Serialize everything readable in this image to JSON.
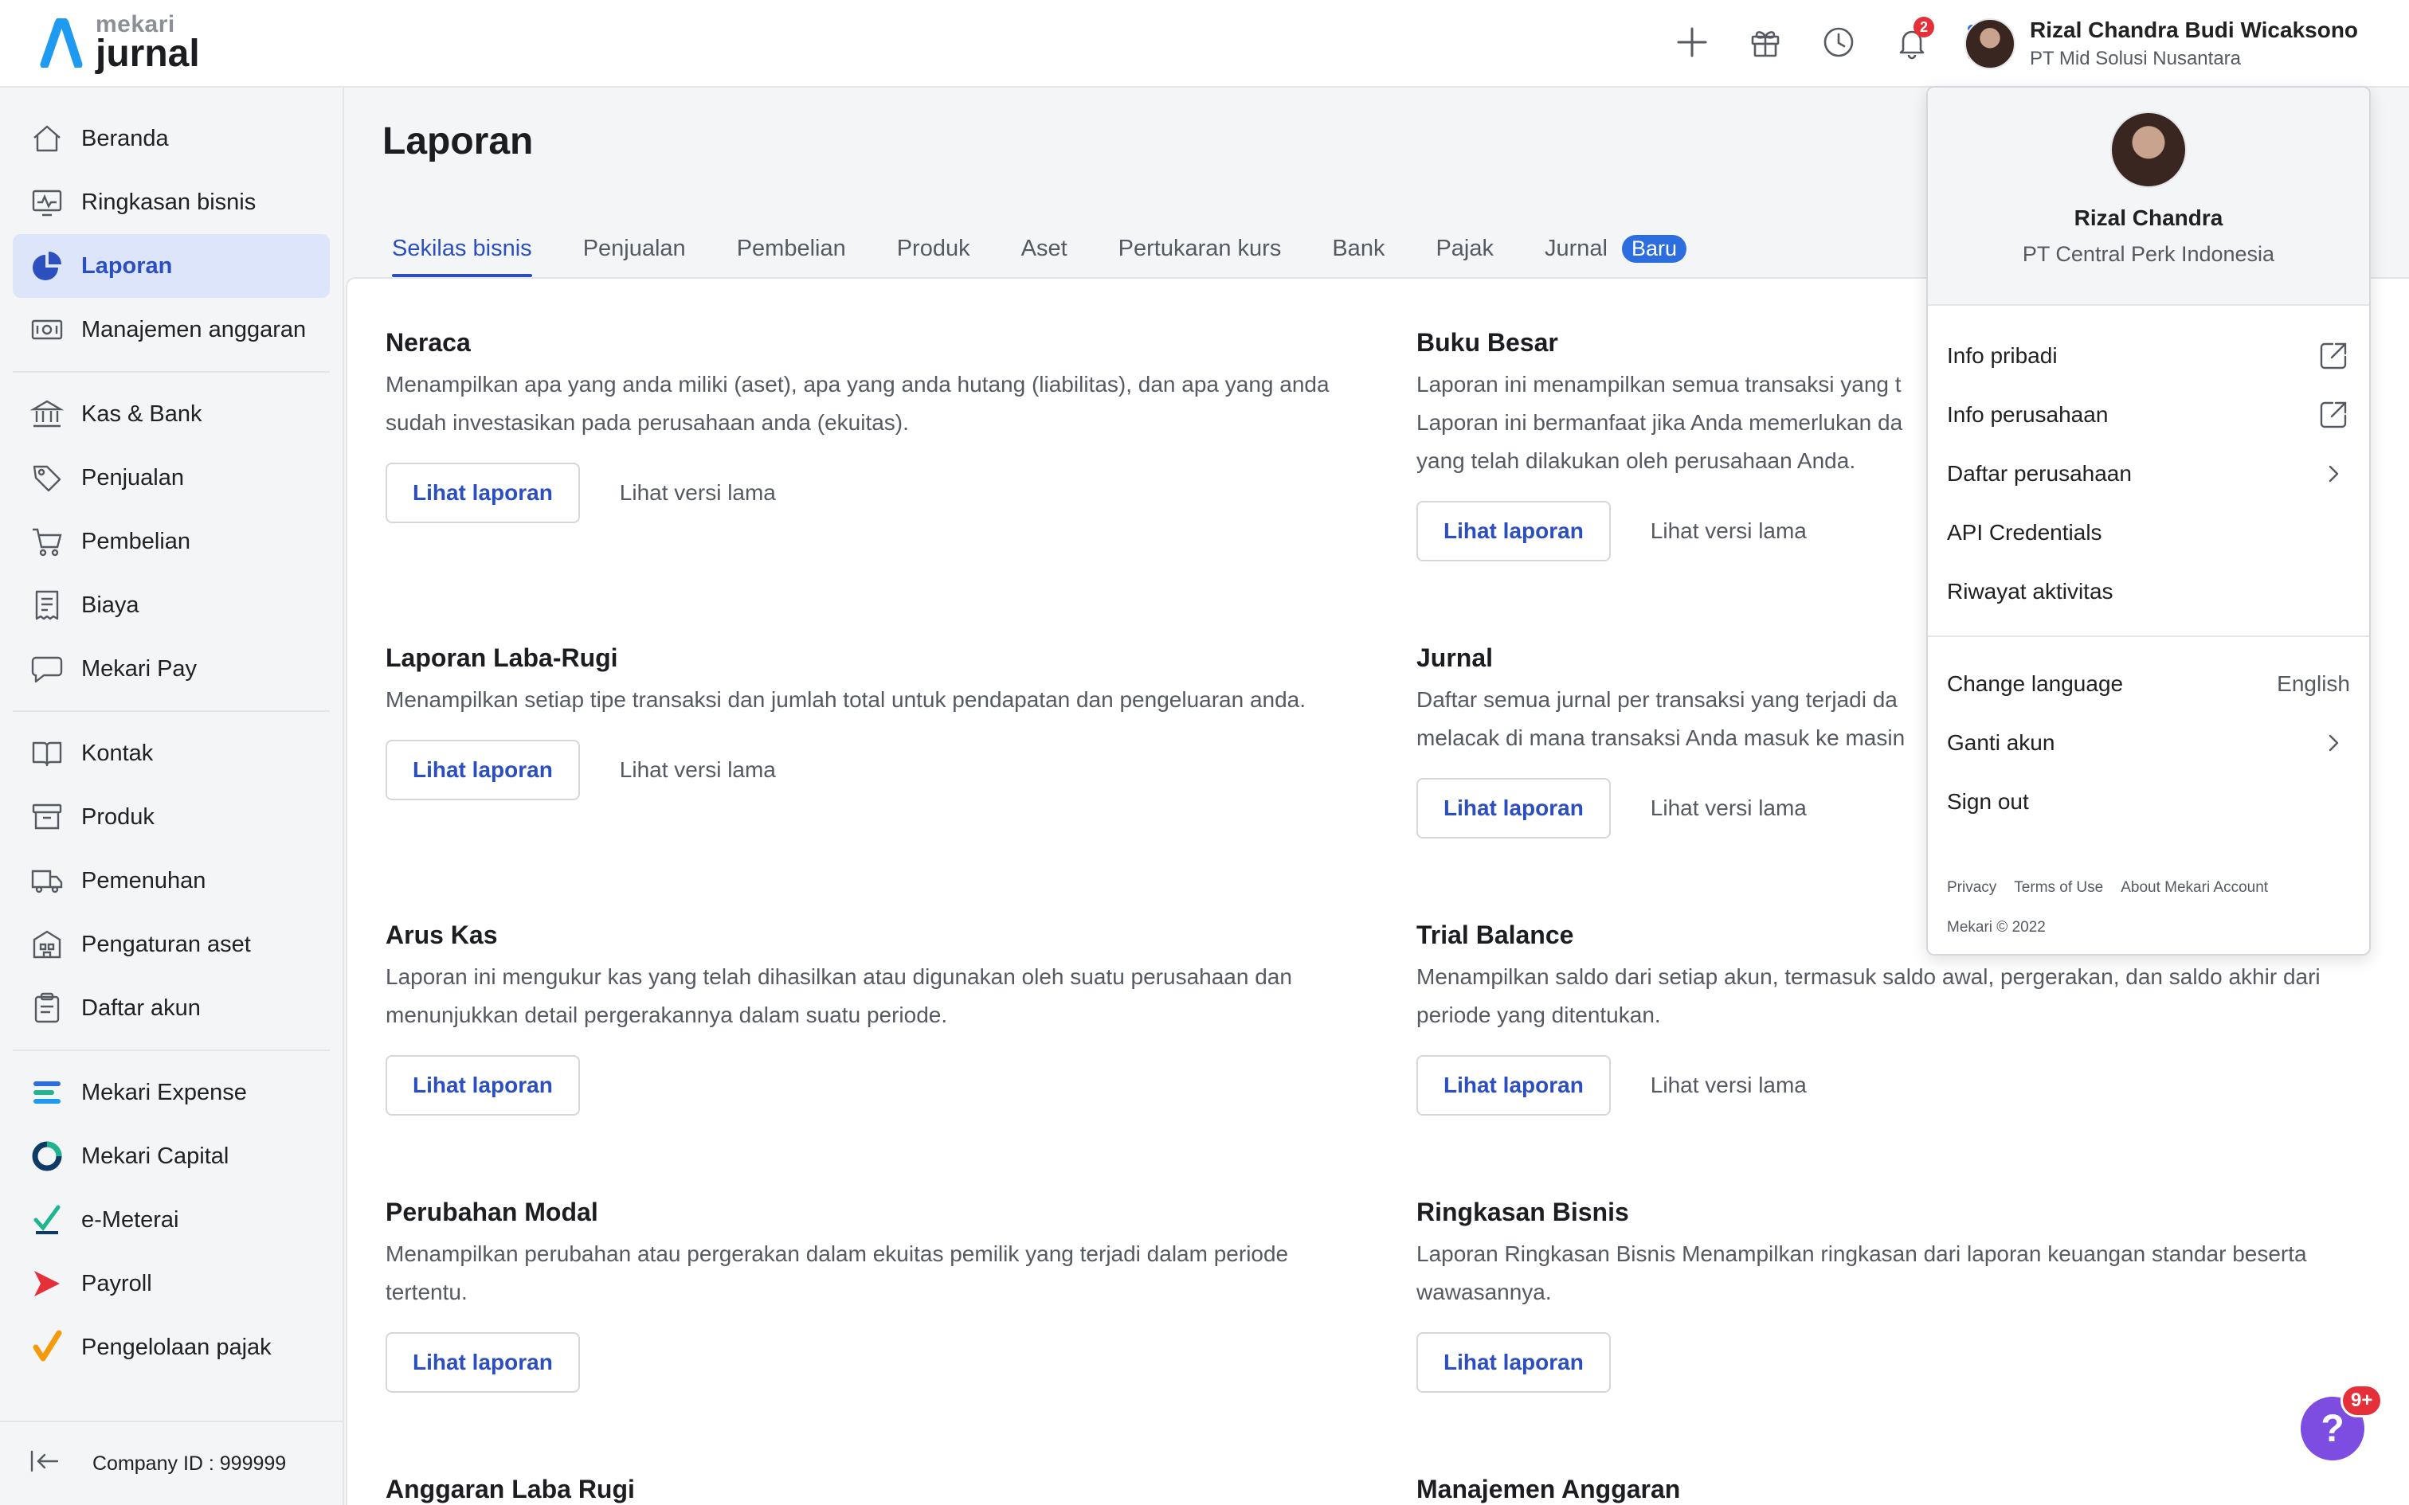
{
  "brand": {
    "name_small": "mekari",
    "name_big": "jurnal"
  },
  "topbar": {
    "notification_count": "2",
    "user_name": "Rizal Chandra Budi Wicaksono",
    "user_company": "PT Mid Solusi Nusantara"
  },
  "sidebar": {
    "groups": [
      [
        {
          "label": "Beranda",
          "icon": "home-icon"
        },
        {
          "label": "Ringkasan bisnis",
          "icon": "monitor-chart-icon"
        },
        {
          "label": "Laporan",
          "icon": "pie-chart-icon",
          "active": true
        },
        {
          "label": "Manajemen anggaran",
          "icon": "money-icon"
        }
      ],
      [
        {
          "label": "Kas & Bank",
          "icon": "bank-icon"
        },
        {
          "label": "Penjualan",
          "icon": "tag-icon"
        },
        {
          "label": "Pembelian",
          "icon": "cart-icon"
        },
        {
          "label": "Biaya",
          "icon": "receipt-icon"
        },
        {
          "label": "Mekari Pay",
          "icon": "chat-bubble-icon"
        }
      ],
      [
        {
          "label": "Kontak",
          "icon": "book-icon"
        },
        {
          "label": "Produk",
          "icon": "box-icon"
        },
        {
          "label": "Pemenuhan",
          "icon": "truck-icon"
        },
        {
          "label": "Pengaturan aset",
          "icon": "building-icon"
        },
        {
          "label": "Daftar akun",
          "icon": "clipboard-icon"
        }
      ],
      [
        {
          "label": "Mekari Expense",
          "icon": "mekari-expense-icon"
        },
        {
          "label": "Mekari Capital",
          "icon": "mekari-capital-icon"
        },
        {
          "label": "e-Meterai",
          "icon": "e-meterai-icon"
        },
        {
          "label": "Payroll",
          "icon": "payroll-icon"
        },
        {
          "label": "Pengelolaan pajak",
          "icon": "tax-check-icon"
        }
      ]
    ],
    "footer": "Company ID : 999999"
  },
  "main": {
    "title": "Laporan",
    "tabs": [
      {
        "label": "Sekilas bisnis",
        "active": true
      },
      {
        "label": "Penjualan"
      },
      {
        "label": "Pembelian"
      },
      {
        "label": "Produk"
      },
      {
        "label": "Aset"
      },
      {
        "label": "Pertukaran kurs"
      },
      {
        "label": "Bank"
      },
      {
        "label": "Pajak"
      },
      {
        "label": "Jurnal",
        "badge": "Baru"
      }
    ],
    "reports": [
      {
        "title": "Neraca",
        "desc": "Menampilkan apa yang anda miliki (aset), apa yang anda hutang (liabilitas), dan apa yang anda sudah investasikan pada perusahaan anda (ekuitas).",
        "primary": "Lihat laporan",
        "secondary": "Lihat versi lama"
      },
      {
        "title": "Buku Besar",
        "desc": "Laporan ini menampilkan semua transaksi yang t Laporan ini bermanfaat jika Anda memerlukan da yang telah dilakukan oleh perusahaan Anda.",
        "primary": "Lihat laporan",
        "secondary": "Lihat versi lama"
      },
      {
        "title": "Laporan Laba-Rugi",
        "desc": "Menampilkan setiap tipe transaksi dan jumlah total untuk pendapatan dan pengeluaran anda.",
        "primary": "Lihat laporan",
        "secondary": "Lihat versi lama"
      },
      {
        "title": "Jurnal",
        "desc": "Daftar semua jurnal per transaksi yang terjadi da melacak di mana transaksi Anda masuk ke masin",
        "primary": "Lihat laporan",
        "secondary": "Lihat versi lama"
      },
      {
        "title": "Arus Kas",
        "desc": "Laporan ini mengukur kas yang telah dihasilkan atau digunakan oleh suatu perusahaan dan menunjukkan detail pergerakannya dalam suatu periode.",
        "primary": "Lihat laporan",
        "secondary": ""
      },
      {
        "title": "Trial Balance",
        "desc": "Menampilkan saldo dari setiap akun, termasuk saldo awal, pergerakan, dan saldo akhir dari periode yang ditentukan.",
        "primary": "Lihat laporan",
        "secondary": "Lihat versi lama"
      },
      {
        "title": "Perubahan Modal",
        "desc": "Menampilkan perubahan atau pergerakan dalam ekuitas pemilik yang terjadi dalam periode tertentu.",
        "primary": "Lihat laporan",
        "secondary": ""
      },
      {
        "title": "Ringkasan Bisnis",
        "desc": "Laporan Ringkasan Bisnis Menampilkan ringkasan dari laporan keuangan standar beserta wawasannya.",
        "primary": "Lihat laporan",
        "secondary": ""
      },
      {
        "title": "Anggaran Laba Rugi",
        "desc": "",
        "primary": "",
        "secondary": ""
      },
      {
        "title": "Manajemen Anggaran",
        "desc": "",
        "primary": "",
        "secondary": ""
      }
    ]
  },
  "dropdown": {
    "name": "Rizal Chandra",
    "company": "PT Central Perk Indonesia",
    "items1": [
      {
        "label": "Info pribadi",
        "icon": "external-link-icon"
      },
      {
        "label": "Info perusahaan",
        "icon": "external-link-icon"
      },
      {
        "label": "Daftar perusahaan",
        "icon": "chevron-right-icon"
      },
      {
        "label": "API Credentials",
        "icon": ""
      },
      {
        "label": "Riwayat aktivitas",
        "icon": ""
      }
    ],
    "language_label": "Change language",
    "language_value": "English",
    "switch_account": "Ganti akun",
    "sign_out": "Sign out",
    "links": [
      "Privacy",
      "Terms of Use",
      "About Mekari Account"
    ],
    "copyright": "Mekari © 2022"
  },
  "help": {
    "icon": "question-icon",
    "badge": "9+"
  },
  "colors": {
    "accent": "#2c4fbf",
    "active_bg": "#dde5fb",
    "badge_blue": "#2c6de0",
    "help_purple": "#7c4de0",
    "alert_red": "#e5303a"
  }
}
